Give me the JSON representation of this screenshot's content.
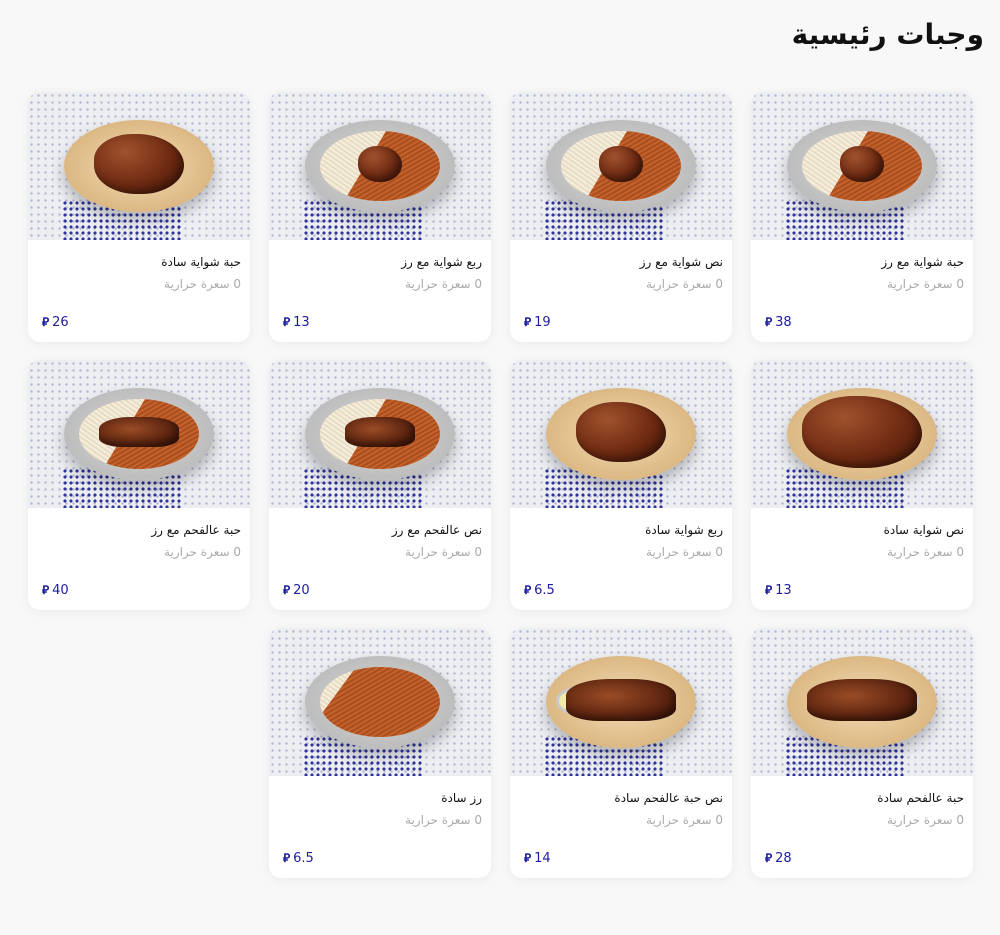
{
  "section": {
    "title": "وجبات رئيسية"
  },
  "currency_color": "#1d1d9e",
  "items": [
    {
      "name": "حبة شواية مع رز",
      "calories": "0 سعرة حرارية",
      "price": "38",
      "image_icon": "chicken-rice-plate"
    },
    {
      "name": "نص شواية مع رز",
      "calories": "0 سعرة حرارية",
      "price": "19",
      "image_icon": "chicken-rice-plate"
    },
    {
      "name": "ربع شواية مع رز",
      "calories": "0 سعرة حرارية",
      "price": "13",
      "image_icon": "chicken-rice-plate"
    },
    {
      "name": "حبة شواية سادة",
      "calories": "0 سعرة حرارية",
      "price": "26",
      "image_icon": "whole-chicken"
    },
    {
      "name": "نص شواية سادة",
      "calories": "0 سعرة حرارية",
      "price": "13",
      "image_icon": "half-chicken-bread"
    },
    {
      "name": "ربع شواية سادة",
      "calories": "0 سعرة حرارية",
      "price": "6.5",
      "image_icon": "quarter-chicken-bread"
    },
    {
      "name": "نص عالفحم مع رز",
      "calories": "0 سعرة حرارية",
      "price": "20",
      "image_icon": "charcoal-chicken-rice"
    },
    {
      "name": "حبة عالفحم مع رز",
      "calories": "0 سعرة حرارية",
      "price": "40",
      "image_icon": "charcoal-chicken-rice"
    },
    {
      "name": "حبة عالفحم سادة",
      "calories": "0 سعرة حرارية",
      "price": "28",
      "image_icon": "charcoal-chicken-plate"
    },
    {
      "name": "نص حبة عالفحم سادة",
      "calories": "0 سعرة حرارية",
      "price": "14",
      "image_icon": "charcoal-half-plate"
    },
    {
      "name": "رز سادة",
      "calories": "0 سعرة حرارية",
      "price": "6.5",
      "image_icon": "rice-plate"
    }
  ]
}
